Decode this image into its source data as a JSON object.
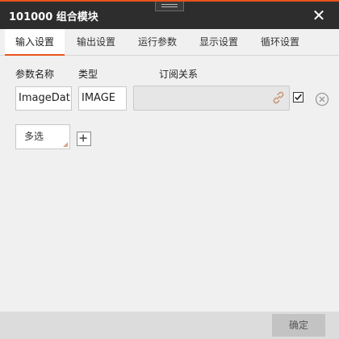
{
  "window": {
    "title": "101000 组合模块",
    "close_icon": "close-icon"
  },
  "tabs": [
    {
      "label": "输入设置",
      "active": true
    },
    {
      "label": "输出设置",
      "active": false
    },
    {
      "label": "运行参数",
      "active": false
    },
    {
      "label": "显示设置",
      "active": false
    },
    {
      "label": "循环设置",
      "active": false
    }
  ],
  "columns": {
    "name": "参数名称",
    "type": "类型",
    "subscription": "订阅关系"
  },
  "params": [
    {
      "name": "ImageDat",
      "type": "IMAGE",
      "subscription": "",
      "checked": true
    }
  ],
  "controls": {
    "multi_select": "多选",
    "add_icon": "plus-icon",
    "link_icon": "link-icon",
    "remove_icon": "remove-icon"
  },
  "footer": {
    "ok_label": "确定"
  },
  "colors": {
    "accent": "#e8531d",
    "titlebar": "#2d2d2d",
    "background": "#f0f0f0"
  }
}
